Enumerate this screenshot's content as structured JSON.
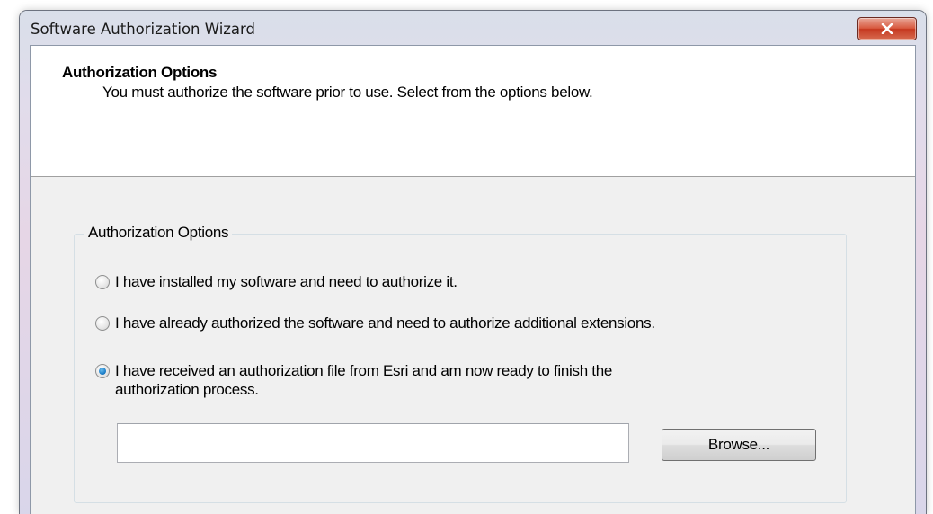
{
  "window": {
    "title": "Software Authorization Wizard"
  },
  "header": {
    "title": "Authorization Options",
    "subtitle": "You must authorize the software prior to use. Select from the options below."
  },
  "group": {
    "label": "Authorization Options",
    "options": [
      {
        "label": "I have installed my software and need to authorize it.",
        "checked": false
      },
      {
        "label": "I have already authorized the software and need to authorize additional extensions.",
        "checked": false
      },
      {
        "label_line1": "I have received an authorization file from Esri and am now ready to finish the",
        "label_line2": "authorization process.",
        "checked": true
      }
    ]
  },
  "file": {
    "value": "",
    "browse_label": "Browse..."
  },
  "colors": {
    "close_button": "#c5381f",
    "radio_selected": "#1e7fc9"
  },
  "icons": {
    "close": "close-x-icon"
  }
}
